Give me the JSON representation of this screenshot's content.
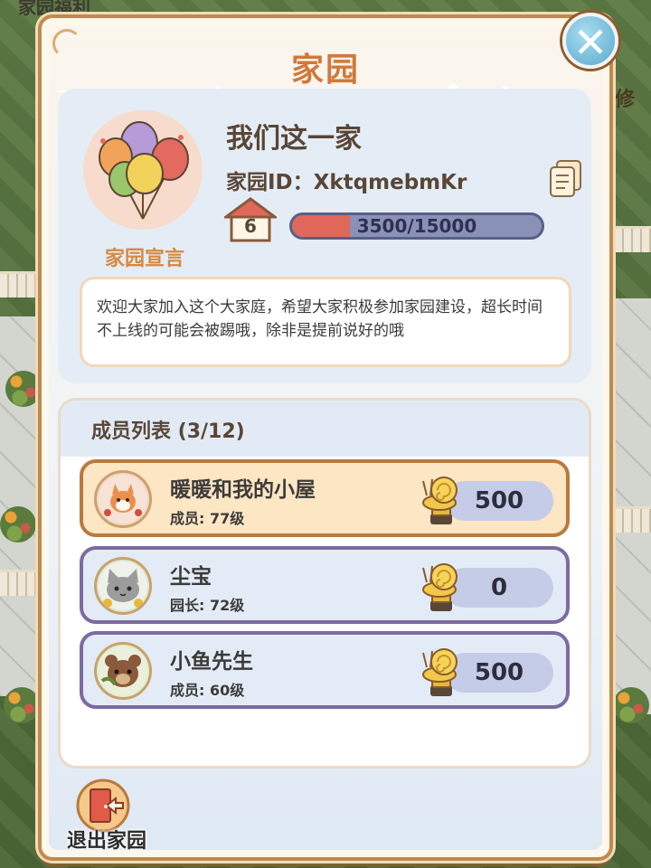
{
  "background": {
    "top_left_text": "家园福利",
    "right_text": "修"
  },
  "panel": {
    "title": "家园"
  },
  "home": {
    "name": "我们这一家",
    "id_label": "家园ID：XktqmebmKr",
    "level": "6",
    "xp_text": "3500/15000",
    "xp_fraction": 0.233,
    "declaration_label": "家园宣言",
    "declaration": "欢迎大家加入这个大家庭，希望大家积极参加家园建设，超长时间不上线的可能会被踢哦，除非是提前说好的哦"
  },
  "members": {
    "title": "成员列表 (3/12)",
    "rows": [
      {
        "name": "暖暖和我的小屋",
        "role": "成员: 77级",
        "score": "500",
        "self": true
      },
      {
        "name": "尘宝",
        "role": "园长: 72级",
        "score": "0",
        "self": false
      },
      {
        "name": "小鱼先生",
        "role": "成员: 60级",
        "score": "500",
        "self": false
      }
    ]
  },
  "exit": {
    "label": "退出家园"
  },
  "colors": {
    "title": "#d0793a",
    "xp_fill": "#e0685a",
    "panel_border": "#c08a4e",
    "row_border": "#7c6aa0",
    "self_row_bg": "#fde6c4"
  },
  "icons": {
    "close": "close-icon",
    "copy": "copy-icon",
    "level": "house-icon",
    "trophy": "snail-trophy-icon",
    "exit": "exit-door-icon",
    "home_avatar": "balloons-icon"
  }
}
